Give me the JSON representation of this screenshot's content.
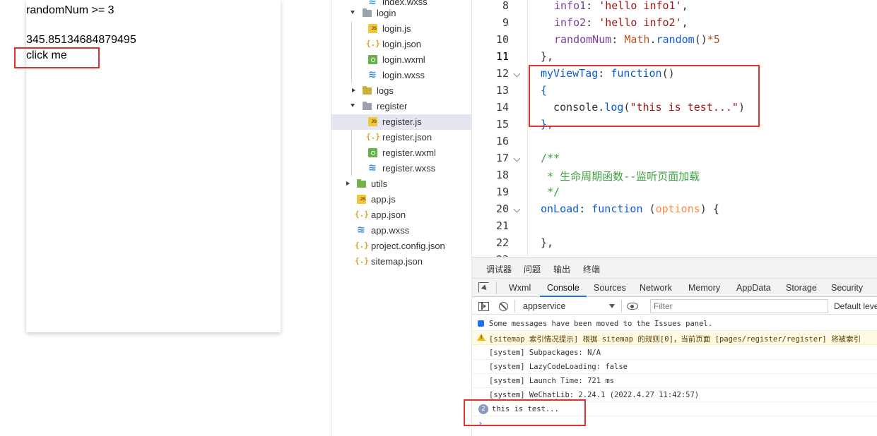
{
  "simulator": {
    "line1": "randomNum >= 3",
    "line2": "345.85134684879495",
    "button_label": "click me"
  },
  "file_tree": {
    "partial_top": "index.wxss",
    "items": [
      {
        "label": "login",
        "type": "folder"
      },
      {
        "label": "login.js",
        "type": "js"
      },
      {
        "label": "login.json",
        "type": "json"
      },
      {
        "label": "login.wxml",
        "type": "wxml"
      },
      {
        "label": "login.wxss",
        "type": "wxss"
      },
      {
        "label": "logs",
        "type": "folder"
      },
      {
        "label": "register",
        "type": "folder"
      },
      {
        "label": "register.js",
        "type": "js",
        "selected": true
      },
      {
        "label": "register.json",
        "type": "json"
      },
      {
        "label": "register.wxml",
        "type": "wxml"
      },
      {
        "label": "register.wxss",
        "type": "wxss"
      },
      {
        "label": "utils",
        "type": "folder"
      },
      {
        "label": "app.js",
        "type": "js"
      },
      {
        "label": "app.json",
        "type": "json"
      },
      {
        "label": "app.wxss",
        "type": "wxss"
      },
      {
        "label": "project.config.json",
        "type": "json"
      },
      {
        "label": "sitemap.json",
        "type": "json"
      }
    ]
  },
  "editor": {
    "lines": [
      {
        "n": "8",
        "parts": [
          [
            "prop",
            "info1"
          ],
          [
            "punc",
            ": "
          ],
          [
            "str",
            "'hello info1'"
          ],
          [
            "punc",
            ","
          ]
        ]
      },
      {
        "n": "9",
        "parts": [
          [
            "prop",
            "info2"
          ],
          [
            "punc",
            ": "
          ],
          [
            "str",
            "'hello info2'"
          ],
          [
            "punc",
            ","
          ]
        ]
      },
      {
        "n": "10",
        "parts": [
          [
            "prop",
            "randomNum"
          ],
          [
            "punc",
            ": "
          ],
          [
            "num",
            "Math"
          ],
          [
            "punc",
            "."
          ],
          [
            "fn",
            "random"
          ],
          [
            "punc",
            "()"
          ],
          [
            "num",
            "*5"
          ]
        ]
      },
      {
        "n": "11",
        "parts": [
          [
            "punc",
            "},"
          ]
        ]
      },
      {
        "n": "12",
        "parts": [
          [
            "fn",
            "myViewTag"
          ],
          [
            "punc",
            ": "
          ],
          [
            "kw",
            "function"
          ],
          [
            "punc",
            "()"
          ]
        ]
      },
      {
        "n": "13",
        "parts": [
          [
            "kw",
            "{"
          ]
        ]
      },
      {
        "n": "14",
        "parts": [
          [
            "punc",
            "  console."
          ],
          [
            "fn",
            "log"
          ],
          [
            "punc",
            "("
          ],
          [
            "str",
            "\"this is test...\""
          ],
          [
            "punc",
            ")"
          ]
        ]
      },
      {
        "n": "15",
        "parts": [
          [
            "kw",
            "},"
          ]
        ]
      },
      {
        "n": "16",
        "parts": []
      },
      {
        "n": "17",
        "parts": [
          [
            "comment",
            "/**"
          ]
        ]
      },
      {
        "n": "18",
        "parts": [
          [
            "comment",
            " * 生命周期函数--监听页面加载"
          ]
        ]
      },
      {
        "n": "19",
        "parts": [
          [
            "comment",
            " */"
          ]
        ]
      },
      {
        "n": "20",
        "parts": [
          [
            "fn",
            "onLoad"
          ],
          [
            "punc",
            ": "
          ],
          [
            "kw",
            "function"
          ],
          [
            "punc",
            " ("
          ],
          [
            "muted",
            "options"
          ],
          [
            "punc",
            ") {"
          ]
        ]
      },
      {
        "n": "21",
        "parts": []
      },
      {
        "n": "22",
        "parts": [
          [
            "punc",
            "},"
          ]
        ]
      },
      {
        "n": "23",
        "parts": []
      }
    ]
  },
  "debugger": {
    "top_tabs": [
      "调试器",
      "问题",
      "输出",
      "终端"
    ],
    "dev_tabs": [
      "Wxml",
      "Console",
      "Sources",
      "Network",
      "Memory",
      "AppData",
      "Storage",
      "Security"
    ],
    "active_dev_tab": "Console",
    "context": "appservice",
    "filter_placeholder": "Filter",
    "levels_label": "Default levels",
    "messages": [
      {
        "kind": "info",
        "text": "Some messages have been moved to the Issues panel."
      },
      {
        "kind": "warn",
        "text": "[sitemap 索引情况提示] 根据 sitemap 的规则[0]，当前页面 [pages/register/register] 将被索引"
      },
      {
        "kind": "log",
        "text": "[system] Subpackages: N/A"
      },
      {
        "kind": "log",
        "text": "[system] LazyCodeLoading: false"
      },
      {
        "kind": "log",
        "text": "[system] Launch Time: 721 ms"
      },
      {
        "kind": "log",
        "text": "[system] WeChatLib: 2.24.1 (2022.4.27 11:42:57)"
      },
      {
        "kind": "repeat",
        "count": "2",
        "text": "this is test..."
      }
    ],
    "prompt": "›"
  },
  "colors": {
    "highlight_box": "#e03030",
    "selected_row": "#e4e6f1",
    "active_tab_underline": "#1a73e8"
  }
}
